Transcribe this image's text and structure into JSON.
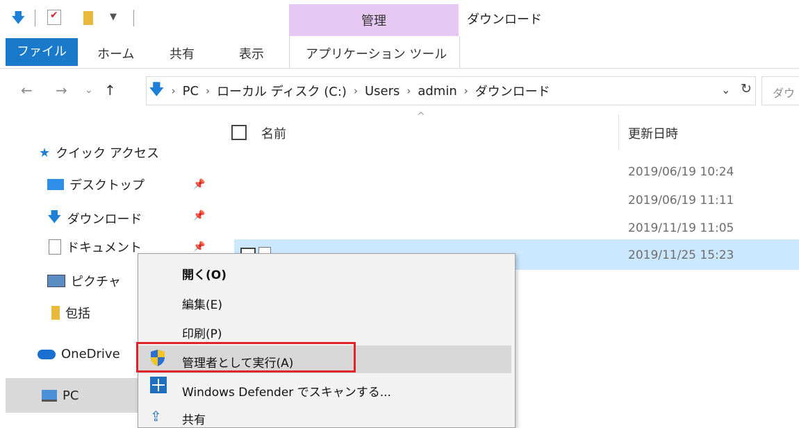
{
  "title_bar": {
    "contextual_tab": "管理",
    "window_title": "ダウンロード"
  },
  "ribbon": {
    "tabs": [
      "ファイル",
      "ホーム",
      "共有",
      "表示",
      "アプリケーション ツール"
    ]
  },
  "address_bar": {
    "breadcrumb": [
      "PC",
      "ローカル ディスク (C:)",
      "Users",
      "admin",
      "ダウンロード"
    ],
    "search_placeholder": "ダウ"
  },
  "file_list": {
    "columns": {
      "name": "名前",
      "modified": "更新日時"
    },
    "dates": [
      "2019/06/19 10:24",
      "2019/06/19 11:11",
      "2019/11/19 11:05",
      "2019/11/25 15:23"
    ]
  },
  "nav_pane": {
    "quick_access": "クイック アクセス",
    "items": [
      {
        "label": "デスクトップ",
        "icon": "desktop-icon",
        "pinned": true
      },
      {
        "label": "ダウンロード",
        "icon": "download-icon",
        "pinned": true
      },
      {
        "label": "ドキュメント",
        "icon": "document-icon",
        "pinned": true
      },
      {
        "label": "ピクチャ",
        "icon": "pictures-icon",
        "pinned": false
      },
      {
        "label": "包括",
        "icon": "folder-icon",
        "pinned": false
      }
    ],
    "onedrive": "OneDrive",
    "pc": "PC"
  },
  "context_menu": {
    "open": "開く(O)",
    "edit": "編集(E)",
    "print": "印刷(P)",
    "run_as_admin": "管理者として実行(A)",
    "defender_scan": "Windows Defender でスキャンする...",
    "share": "共有"
  },
  "colors": {
    "accent": "#1979ca",
    "manage_tab": "#e6c8f2",
    "selection": "#cce8ff",
    "highlight_box": "#e0222a"
  }
}
